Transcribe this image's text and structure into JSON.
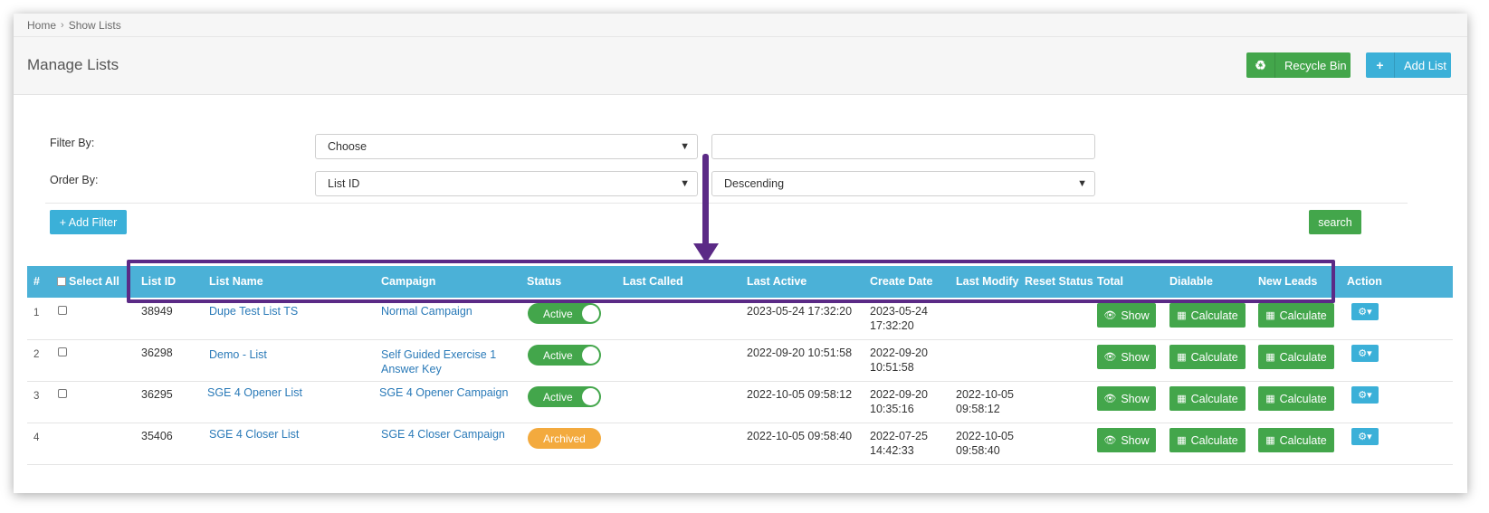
{
  "breadcrumb": {
    "home": "Home",
    "current": "Show Lists"
  },
  "page_title": "Manage Lists",
  "buttons": {
    "recycle_bin": "Recycle Bin",
    "add_list": "Add List",
    "add_filter": "+ Add Filter",
    "search": "search"
  },
  "filter": {
    "filter_by_label": "Filter By:",
    "filter_by_value": "Choose",
    "filter_text_value": "",
    "order_by_label": "Order By:",
    "order_by_value": "List ID",
    "order_direction_value": "Descending"
  },
  "table": {
    "columns": [
      "#",
      "Select All",
      "List ID",
      "List Name",
      "Campaign",
      "Status",
      "Last Called",
      "Last Active",
      "Create Date",
      "Last Modify",
      "Reset Status",
      "Total",
      "Dialable",
      "New Leads",
      "Action"
    ],
    "rows": [
      {
        "num": "1",
        "list_id": "38949",
        "list_name": "Dupe Test List TS",
        "campaign": "Normal Campaign",
        "status": "Active",
        "last_called": "",
        "last_active": "2023-05-24 17:32:20",
        "create_date_1": "2023-05-24",
        "create_date_2": "17:32:20",
        "modify_1": "",
        "modify_2": "",
        "total": "Show",
        "dialable": "Calculate",
        "new_leads": "Calculate"
      },
      {
        "num": "2",
        "list_id": "36298",
        "list_name": "Demo - List",
        "campaign": "Self Guided Exercise 1 Answer Key",
        "status": "Active",
        "last_called": "",
        "last_active": "2022-09-20 10:51:58",
        "create_date_1": "2022-09-20",
        "create_date_2": "10:51:58",
        "modify_1": "",
        "modify_2": "",
        "total": "Show",
        "dialable": "Calculate",
        "new_leads": "Calculate"
      },
      {
        "num": "3",
        "list_id": "36295",
        "list_name": "SGE 4 Opener List",
        "campaign": "SGE 4 Opener Campaign",
        "status": "Active",
        "last_called": "",
        "last_active": "2022-10-05 09:58:12",
        "create_date_1": "2022-09-20",
        "create_date_2": "10:35:16",
        "modify_1": "2022-10-05",
        "modify_2": "09:58:12",
        "total": "Show",
        "dialable": "Calculate",
        "new_leads": "Calculate"
      },
      {
        "num": "4",
        "list_id": "35406",
        "list_name": "SGE 4 Closer List",
        "campaign": "SGE 4 Closer Campaign",
        "status": "Archived",
        "last_called": "",
        "last_active": "2022-10-05 09:58:40",
        "create_date_1": "2022-07-25",
        "create_date_2": "14:42:33",
        "modify_1": "2022-10-05",
        "modify_2": "09:58:40",
        "total": "Show",
        "dialable": "Calculate",
        "new_leads": "Calculate"
      }
    ]
  },
  "colors": {
    "header_blue": "#4bb1d7",
    "green": "#43a64b",
    "orange": "#f3aa3e",
    "annotation_purple": "#5b2a86",
    "link_blue": "#2a7ab8"
  },
  "icons": {
    "recycle": "recycle-icon",
    "add": "plus-icon",
    "eye": "eye-icon",
    "calculator": "calculator-icon",
    "gear": "gear-icon"
  }
}
